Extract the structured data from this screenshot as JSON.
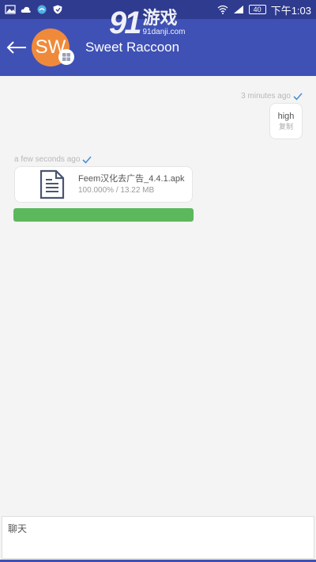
{
  "status_bar": {
    "battery": "40",
    "time": "下午1:03"
  },
  "watermark": {
    "logo": "91",
    "title": "游戏",
    "url": "91danji.com"
  },
  "header": {
    "avatar_initials": "SW",
    "contact_name": "Sweet Raccoon"
  },
  "messages": {
    "sent_text": {
      "time": "3 minutes ago",
      "text": "high",
      "copy_label": "复制"
    },
    "file": {
      "time": "a few seconds ago",
      "name": "Feem汉化去广告_4.4.1.apk",
      "progress_text": "100.000% / 13.22 MB",
      "progress": 1.0
    }
  },
  "input": {
    "placeholder": "聊天"
  },
  "colors": {
    "status_bar": "#2f3b8f",
    "header": "#3f51b5",
    "avatar": "#f08a3b",
    "progress": "#5cb85c",
    "check": "#4a90d9",
    "doc_icon": "#4a5570"
  }
}
